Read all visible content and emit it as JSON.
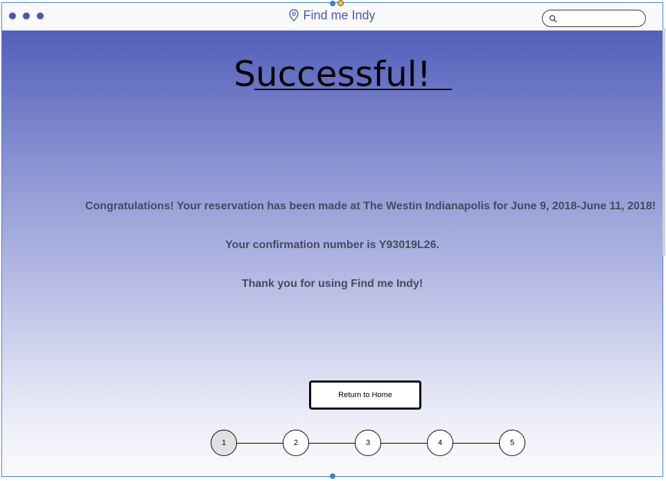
{
  "app": {
    "title": "Find me Indy"
  },
  "search": {
    "placeholder": ""
  },
  "page": {
    "heading": "Successful!",
    "messages": [
      "Congratulations! Your reservation has been made at The Westin Indianapolis for June 9, 2018-June 11, 2018!",
      "Your confirmation number is Y93019L26.",
      "Thank you for using Find me Indy!"
    ],
    "home_button": "Return to Home"
  },
  "steps": [
    "1",
    "2",
    "3",
    "4",
    "5"
  ],
  "colors": {
    "brand": "#4a57b5",
    "selection": "#3b82d6"
  },
  "icons": {
    "brand": "location-pin-icon",
    "search": "search-icon"
  }
}
